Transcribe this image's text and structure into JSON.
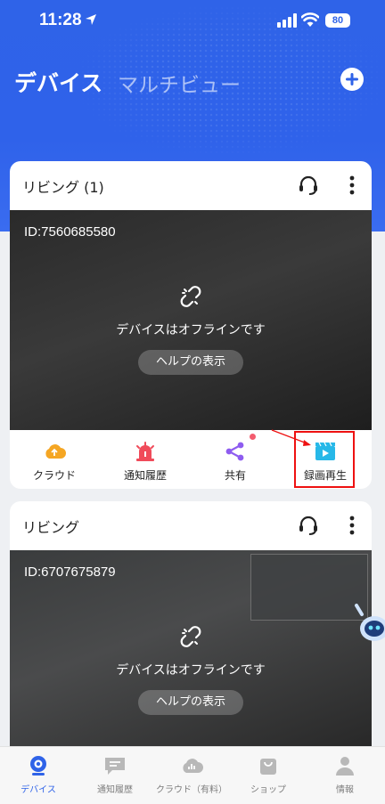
{
  "status_bar": {
    "time": "11:28",
    "battery": "80"
  },
  "header": {
    "title": "デバイス",
    "secondary_tab": "マルチビュー"
  },
  "cards": [
    {
      "title": "リビング (1)",
      "device_id": "ID:7560685580",
      "offline_text": "デバイスはオフラインです",
      "help_label": "ヘルプの表示",
      "actions": [
        "クラウド",
        "通知履歴",
        "共有",
        "録画再生"
      ]
    },
    {
      "title": "リビング",
      "device_id": "ID:6707675879",
      "offline_text": "デバイスはオフラインです",
      "help_label": "ヘルプの表示"
    }
  ],
  "tabs": [
    "デバイス",
    "通知履歴",
    "クラウド（有料）",
    "ショップ",
    "情報"
  ],
  "colors": {
    "accent": "#2f63e8",
    "highlight": "#e11111"
  }
}
